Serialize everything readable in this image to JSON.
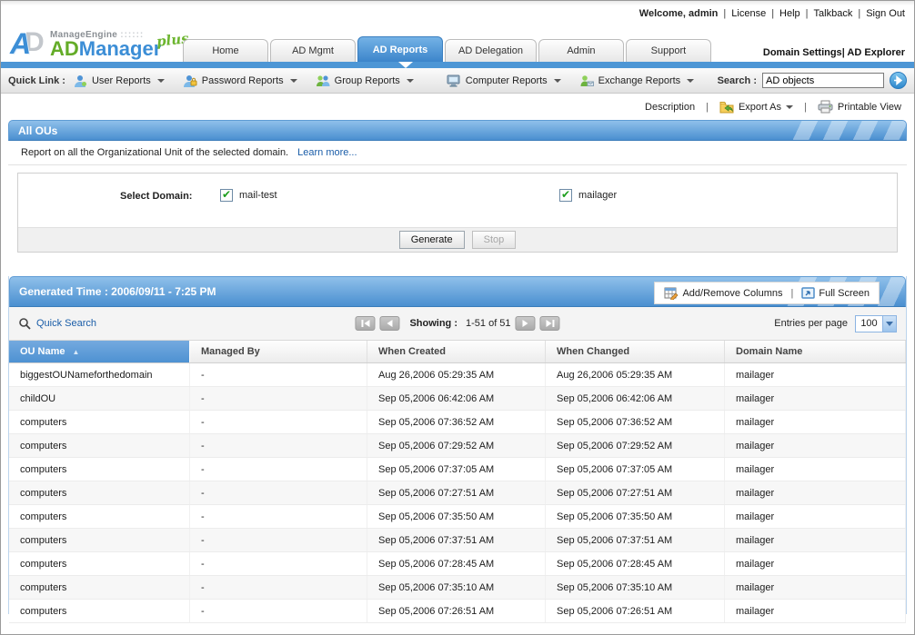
{
  "topbar": {
    "welcome": "Welcome, admin",
    "separator": "|",
    "links": [
      "License",
      "Help",
      "Talkback",
      "Sign Out"
    ]
  },
  "logo": {
    "brand": "ManageEngine",
    "brand_dots": "::::::",
    "product_ad": "AD",
    "product_manager": "Manager",
    "product_plus": "plus"
  },
  "tabs": [
    {
      "label": "Home"
    },
    {
      "label": "AD Mgmt"
    },
    {
      "label": "AD Reports"
    },
    {
      "label": "AD Delegation"
    },
    {
      "label": "Admin"
    },
    {
      "label": "Support"
    }
  ],
  "header_right": {
    "domain_settings": "Domain Settings",
    "separator": "|",
    "ad_explorer": "AD Explorer"
  },
  "quicklink": {
    "label": "Quick Link :",
    "menus": [
      "User Reports",
      "Password Reports",
      "Group Reports",
      "Computer Reports",
      "Exchange Reports"
    ],
    "search_label": "Search :",
    "search_value": "AD objects"
  },
  "toolbar": {
    "description": "Description",
    "separator": "|",
    "export_as": "Export As",
    "printable_view": "Printable View"
  },
  "report": {
    "title": "All OUs",
    "description": "Report on all the Organizational Unit of the selected domain.",
    "learn_more": "Learn more...",
    "select_domain_label": "Select Domain:",
    "domains": [
      {
        "name": "mail-test",
        "checked": true
      },
      {
        "name": "mailager",
        "checked": true
      }
    ],
    "generate_label": "Generate",
    "stop_label": "Stop"
  },
  "results": {
    "generated_time": "Generated Time : 2006/09/11 - 7:25 PM",
    "add_remove_columns": "Add/Remove Columns",
    "separator": "|",
    "full_screen": "Full Screen",
    "quick_search": "Quick Search",
    "showing_label": "Showing :",
    "showing_value": "1-51 of 51",
    "entries_per_page_label": "Entries per page",
    "entries_per_page_value": "100"
  },
  "table": {
    "columns": [
      "OU Name",
      "Managed By",
      "When Created",
      "When Changed",
      "Domain Name"
    ],
    "sorted_column": "OU Name",
    "sort_direction": "asc",
    "rows": [
      [
        "biggestOUNameforthedomain",
        "-",
        "Aug 26,2006 05:29:35 AM",
        "Aug 26,2006 05:29:35 AM",
        "mailager"
      ],
      [
        "childOU",
        "-",
        "Sep 05,2006 06:42:06 AM",
        "Sep 05,2006 06:42:06 AM",
        "mailager"
      ],
      [
        "computers",
        "-",
        "Sep 05,2006 07:36:52 AM",
        "Sep 05,2006 07:36:52 AM",
        "mailager"
      ],
      [
        "computers",
        "-",
        "Sep 05,2006 07:29:52 AM",
        "Sep 05,2006 07:29:52 AM",
        "mailager"
      ],
      [
        "computers",
        "-",
        "Sep 05,2006 07:37:05 AM",
        "Sep 05,2006 07:37:05 AM",
        "mailager"
      ],
      [
        "computers",
        "-",
        "Sep 05,2006 07:27:51 AM",
        "Sep 05,2006 07:27:51 AM",
        "mailager"
      ],
      [
        "computers",
        "-",
        "Sep 05,2006 07:35:50 AM",
        "Sep 05,2006 07:35:50 AM",
        "mailager"
      ],
      [
        "computers",
        "-",
        "Sep 05,2006 07:37:51 AM",
        "Sep 05,2006 07:37:51 AM",
        "mailager"
      ],
      [
        "computers",
        "-",
        "Sep 05,2006 07:28:45 AM",
        "Sep 05,2006 07:28:45 AM",
        "mailager"
      ],
      [
        "computers",
        "-",
        "Sep 05,2006 07:35:10 AM",
        "Sep 05,2006 07:35:10 AM",
        "mailager"
      ],
      [
        "computers",
        "-",
        "Sep 05,2006 07:26:51 AM",
        "Sep 05,2006 07:26:51 AM",
        "mailager"
      ]
    ]
  },
  "colors": {
    "accent_blue": "#4d96d5",
    "banner_gradient_top": "#8fc0ea",
    "banner_gradient_bottom": "#4a8fd0",
    "link_blue": "#1a5da8",
    "check_green": "#1e9e1e"
  }
}
